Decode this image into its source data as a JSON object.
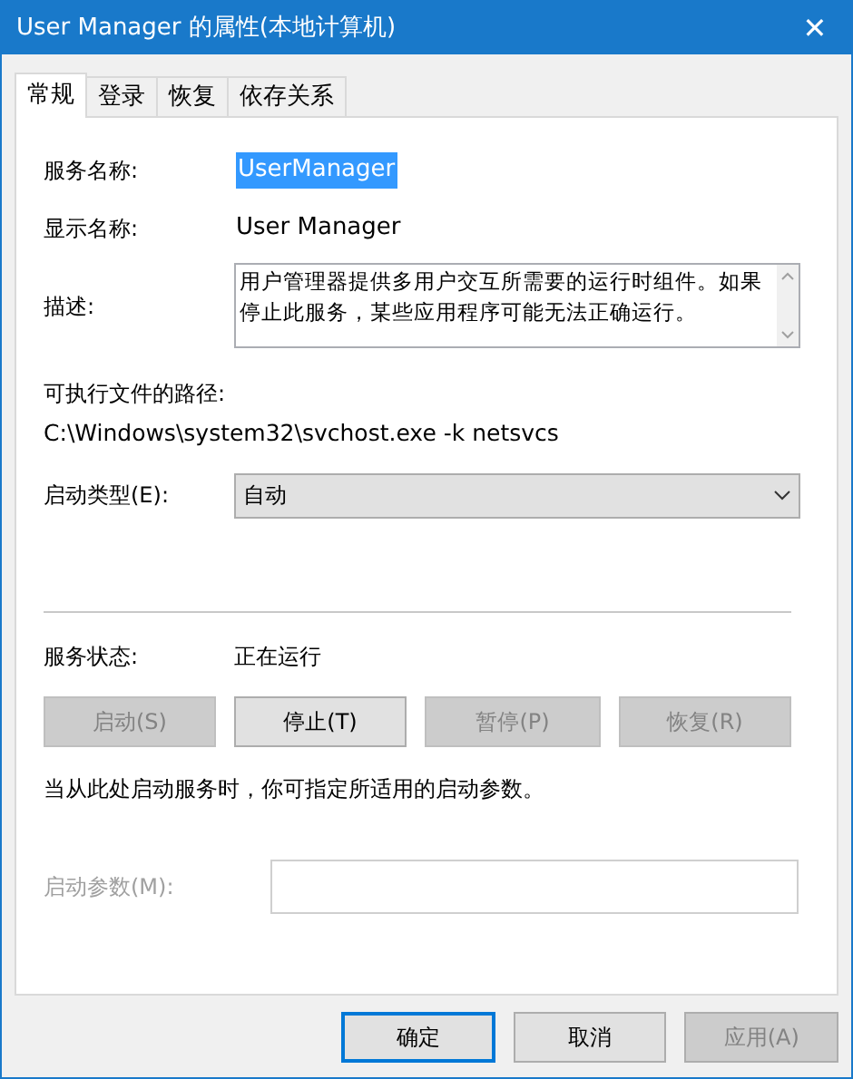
{
  "window": {
    "title": "User Manager 的属性(本地计算机)",
    "close": "✕"
  },
  "tabs": [
    {
      "label": "常规",
      "selected": true
    },
    {
      "label": "登录",
      "selected": false
    },
    {
      "label": "恢复",
      "selected": false
    },
    {
      "label": "依存关系",
      "selected": false
    }
  ],
  "service_name": {
    "label": "服务名称:",
    "value": "UserManager",
    "selected": true
  },
  "display_name": {
    "label": "显示名称:",
    "value": "User Manager"
  },
  "description": {
    "label": "描述:",
    "value": "用户管理器提供多用户交互所需要的运行时组件。如果停止此服务，某些应用程序可能无法正确运行。"
  },
  "path": {
    "label": "可执行文件的路径:",
    "value": "C:\\Windows\\system32\\svchost.exe -k netsvcs"
  },
  "startup_type": {
    "label": "启动类型(E):",
    "value": "自动"
  },
  "service_status": {
    "label": "服务状态:",
    "value": "正在运行"
  },
  "control_buttons": [
    {
      "label": "启动(S)",
      "disabled": true
    },
    {
      "label": "停止(T)",
      "disabled": false
    },
    {
      "label": "暂停(P)",
      "disabled": true
    },
    {
      "label": "恢复(R)",
      "disabled": true
    }
  ],
  "hint": "当从此处启动服务时，你可指定所适用的启动参数。",
  "start_parameters": {
    "label": "启动参数(M):",
    "disabled": true
  },
  "dialog_buttons": [
    {
      "label": "确定",
      "disabled": false,
      "default": true
    },
    {
      "label": "取消",
      "disabled": false,
      "default": false
    },
    {
      "label": "应用(A)",
      "disabled": true,
      "default": false
    }
  ]
}
